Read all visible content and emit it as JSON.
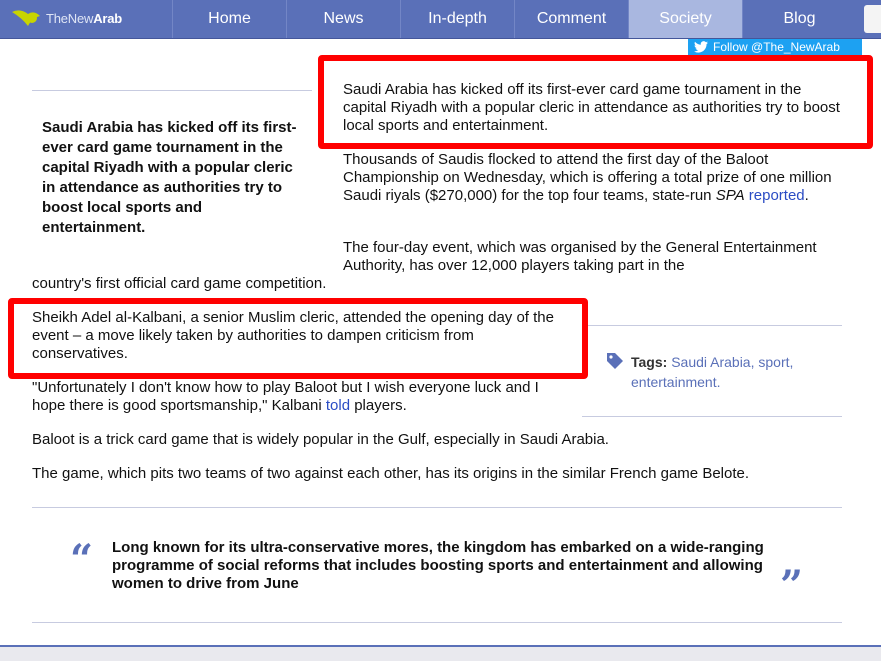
{
  "nav": {
    "logo_prefix": "TheNew",
    "logo_suffix": "Arab",
    "items": [
      {
        "label": "Home"
      },
      {
        "label": "News"
      },
      {
        "label": "In-depth"
      },
      {
        "label": "Comment"
      },
      {
        "label": "Society"
      },
      {
        "label": "Blog"
      }
    ],
    "active": "Society"
  },
  "follow": {
    "label": "Follow @The_NewArab"
  },
  "standfirst": "Saudi Arabia has kicked off its first-ever card game tournament in the capital Riyadh with a popular cleric in attendance as authorities try to boost local sports and entertainment.",
  "article": {
    "p1": "Saudi Arabia has kicked off its first-ever card game tournament in the capital Riyadh with a popular cleric in attendance as authorities try to boost local sports and entertainment.",
    "p2_main": "Thousands of Saudis flocked to attend the first day of the Baloot Championship on Wednesday, which is offering a total prize of one million Saudi riyals ($270,000) for the top four teams, state-run",
    "p2_source": "SPA",
    "p2_link": "reported",
    "p2_end": ".",
    "p3_a": "The four-day event, which was organised by the General Entertainment Authority, has over 12,000 players taking part in the",
    "p3_b": "country's first official card game competition.",
    "p4": "Sheikh Adel al-Kalbani, a senior Muslim cleric, attended the opening day of the event – a move likely taken by authorities to dampen criticism from conservatives.",
    "p5_main": "\"Unfortunately I don't know how to play Baloot but I wish everyone luck and I hope there is good sportsmanship,\" Kalbani",
    "p5_link": "told",
    "p5_end": "players.",
    "p6": "Baloot is a trick card game that is widely popular in the Gulf, especially in Saudi Arabia.",
    "p7": "The game, which pits two teams of two against each other, has its origins in the similar French game Belote."
  },
  "tags": {
    "label": "Tags:",
    "items": [
      "Saudi Arabia",
      "sport",
      "entertainment"
    ]
  },
  "pullquote": "Long known for its ultra-conservative mores, the kingdom has embarked on a wide-ranging programme of social reforms that includes boosting sports and entertainment and allowing women to drive from June",
  "colors": {
    "nav_bg": "#5a70b8",
    "nav_active": "#a9b7e0",
    "twitter": "#1da1f2",
    "link": "#2a4cc4",
    "highlight": "#ff0000"
  }
}
